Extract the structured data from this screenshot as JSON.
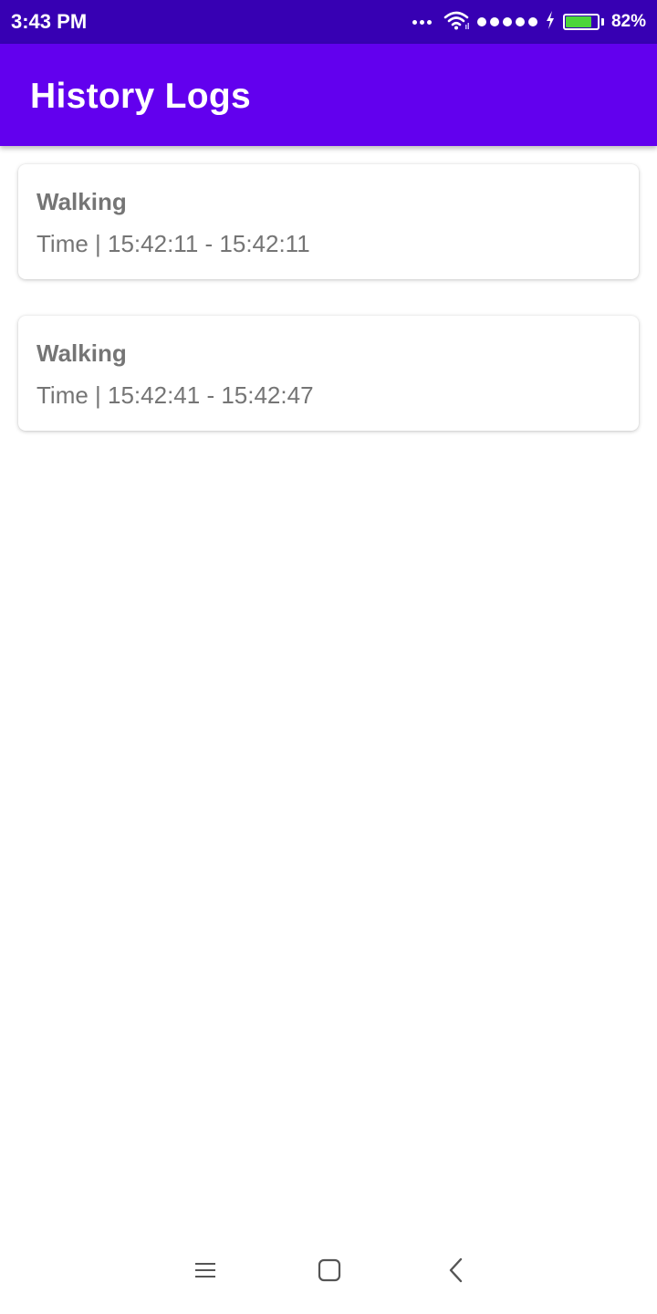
{
  "status_bar": {
    "time": "3:43 PM",
    "battery_percent": "82%",
    "battery_level": 0.82,
    "icons": [
      "more-dots-icon",
      "wifi-icon",
      "signal-dots-icon",
      "charging-icon",
      "battery-icon"
    ]
  },
  "app_bar": {
    "title": "History Logs"
  },
  "logs": [
    {
      "activity": "Walking",
      "time": "Time | 15:42:11 - 15:42:11"
    },
    {
      "activity": "Walking",
      "time": "Time | 15:42:41 - 15:42:47"
    }
  ],
  "nav_bar": {
    "icons": [
      "menu-icon",
      "home-icon",
      "back-icon"
    ]
  },
  "colors": {
    "status_bar": "#3700b3",
    "app_bar": "#6200ee",
    "card_text": "#757575",
    "battery_fill": "#4cd53a"
  }
}
